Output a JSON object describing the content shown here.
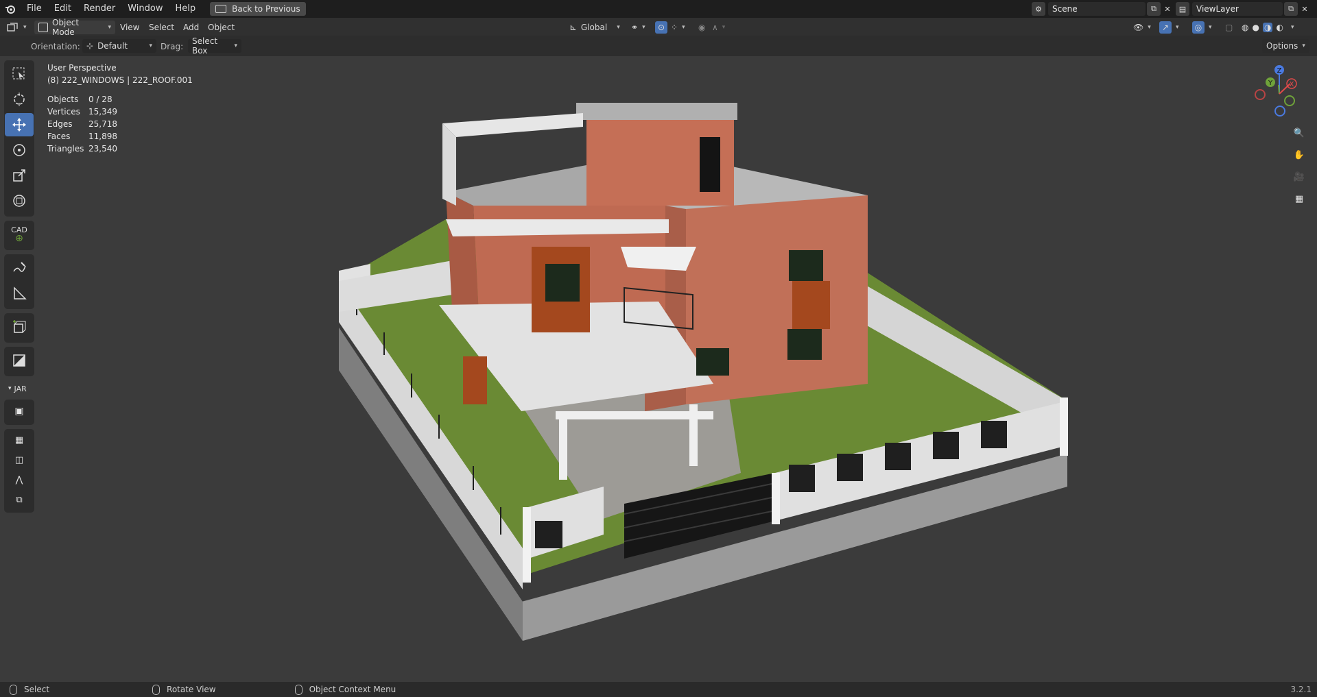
{
  "menubar": {
    "items": [
      "File",
      "Edit",
      "Render",
      "Window",
      "Help"
    ],
    "back_label": "Back to Previous",
    "scene": "Scene",
    "view_layer": "ViewLayer"
  },
  "header": {
    "mode": "Object Mode",
    "menus": [
      "View",
      "Select",
      "Add",
      "Object"
    ],
    "transform_orientation": "Global"
  },
  "tool_settings": {
    "orientation_label": "Orientation:",
    "orientation_value": "Default",
    "drag_label": "Drag:",
    "drag_value": "Select Box",
    "options_label": "Options"
  },
  "overlay_text": {
    "view_name": "User Perspective",
    "active_object": "(8) 222_WINDOWS | 222_ROOF.001",
    "stats": [
      {
        "label": "Objects",
        "value": "0 / 28"
      },
      {
        "label": "Vertices",
        "value": "15,349"
      },
      {
        "label": "Edges",
        "value": "25,718"
      },
      {
        "label": "Faces",
        "value": "11,898"
      },
      {
        "label": "Triangles",
        "value": "23,540"
      }
    ]
  },
  "toolbar": {
    "cad_label": "CAD",
    "panel_label": "JAR"
  },
  "gizmo": {
    "x": "X",
    "y": "Y",
    "z": "Z"
  },
  "statusbar": {
    "items": [
      "Select",
      "Rotate View",
      "Object Context Menu"
    ],
    "version": "3.2.1"
  },
  "colors": {
    "accent": "#4772b3",
    "brick": "#b5614f",
    "grass": "#5b7a2e",
    "wall": "#d6d6d6"
  }
}
